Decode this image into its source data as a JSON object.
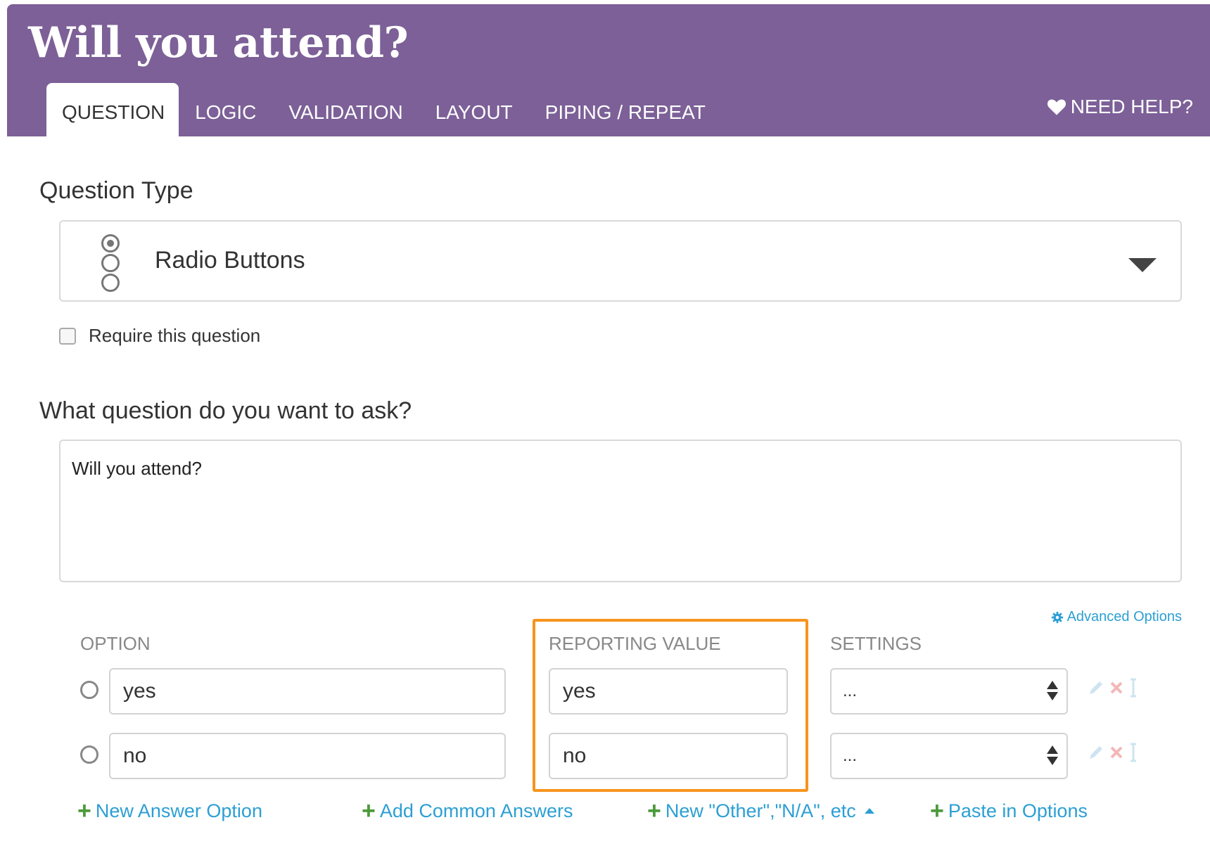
{
  "header": {
    "title": "Will you attend?",
    "tabs": [
      {
        "label": "QUESTION",
        "active": true
      },
      {
        "label": "LOGIC"
      },
      {
        "label": "VALIDATION"
      },
      {
        "label": "LAYOUT"
      },
      {
        "label": "PIPING / REPEAT"
      }
    ],
    "help_label": "NEED HELP?",
    "help_icon": "heart-icon"
  },
  "question_type": {
    "label": "Question Type",
    "selected": "Radio Buttons",
    "icon": "radio-buttons-icon"
  },
  "require": {
    "label": "Require this question",
    "checked": false
  },
  "question_text": {
    "label": "What question do you want to ask?",
    "value": "Will you attend?"
  },
  "options_table": {
    "advanced_label": "Advanced Options",
    "columns": {
      "option": "OPTION",
      "reporting": "REPORTING VALUE",
      "settings": "SETTINGS"
    },
    "rows": [
      {
        "option": "yes",
        "reporting": "yes",
        "settings": "..."
      },
      {
        "option": "no",
        "reporting": "no",
        "settings": "..."
      }
    ],
    "highlight_color": "#f7941d"
  },
  "actions": {
    "new_answer": "New Answer Option",
    "common_answers": "Add Common Answers",
    "other_na": "New \"Other\",\"N/A\", etc",
    "paste_options": "Paste in Options"
  },
  "colors": {
    "header_bg": "#7c6097",
    "link": "#2c9fd4",
    "plus": "#4b9a3a"
  }
}
